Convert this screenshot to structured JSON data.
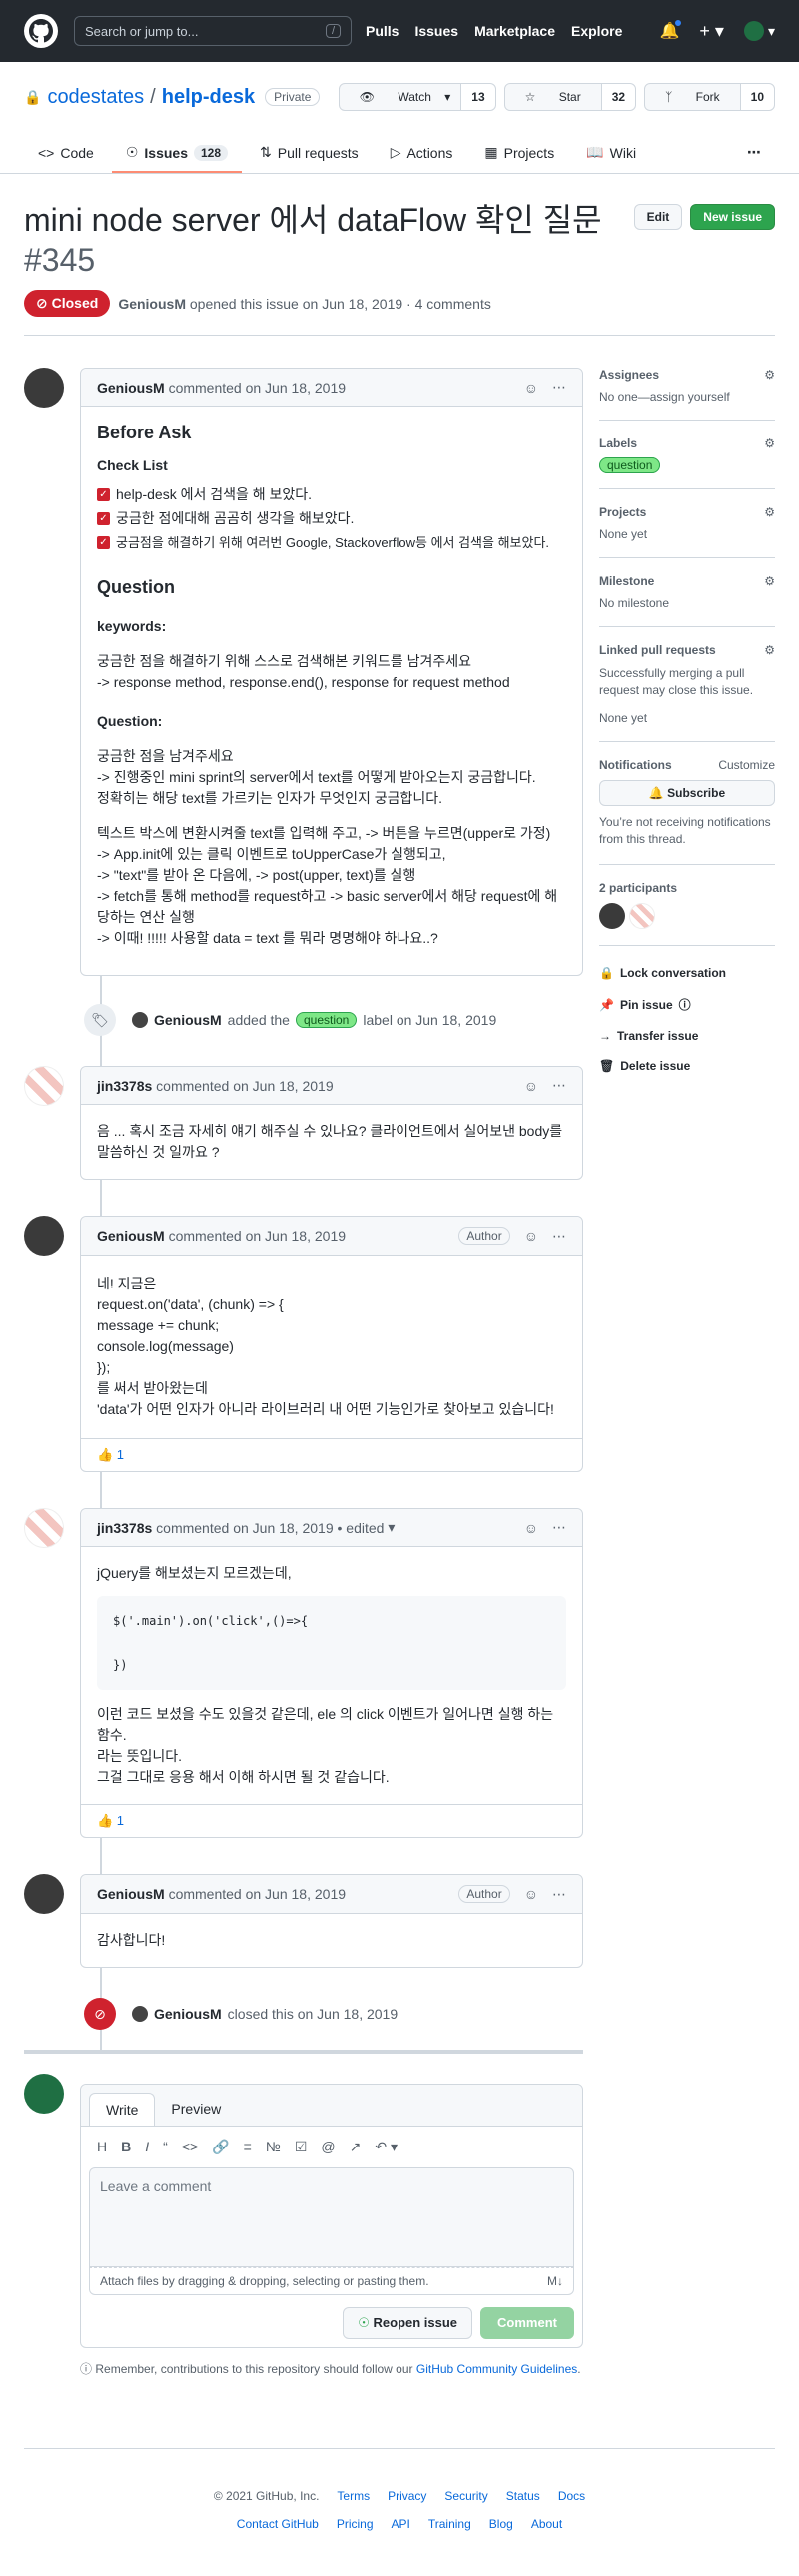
{
  "header": {
    "search_placeholder": "Search or jump to...",
    "slash": "/",
    "nav": [
      "Pulls",
      "Issues",
      "Marketplace",
      "Explore"
    ]
  },
  "repo": {
    "owner": "codestates",
    "sep": "/",
    "name": "help-desk",
    "visibility": "Private",
    "watch": "Watch",
    "watch_count": "13",
    "star": "Star",
    "star_count": "32",
    "fork": "Fork",
    "fork_count": "10"
  },
  "tabs": {
    "code": "Code",
    "issues": "Issues",
    "issues_count": "128",
    "pull_requests": "Pull requests",
    "actions": "Actions",
    "projects": "Projects",
    "wiki": "Wiki"
  },
  "issue": {
    "title": "mini node server 에서 dataFlow 확인 질문",
    "number": "#345",
    "edit": "Edit",
    "new_issue": "New issue",
    "state": "Closed",
    "author": "GeniousM",
    "meta": "opened this issue on Jun 18, 2019 · 4 comments"
  },
  "c1": {
    "author": "GeniousM",
    "meta": "commented on Jun 18, 2019",
    "h_before": "Before Ask",
    "h_check": "Check List",
    "checks": [
      "help-desk 에서 검색을 해 보았다.",
      "궁금한 점에대해 곰곰히 생각을 해보았다.",
      "궁금점을 해결하기 위해 여러번 Google, Stackoverflow등 에서 검색을 해보았다."
    ],
    "h_question": "Question",
    "h_keywords": "keywords:",
    "kw1": "궁금한 점을 해결하기 위해 스스로 검색해본 키워드를 남겨주세요",
    "kw2": "-> response method, response.end(), response for request method",
    "h_question2": "Question:",
    "q1": "궁금한 점을 남겨주세요",
    "q2": "-> 진행중인 mini sprint의 server에서 text를 어떻게 받아오는지 궁금합니다.",
    "q3": "정확히는 해당 text를 가르키는 인자가 무엇인지 궁금합니다.",
    "q4": "텍스트 박스에 변환시켜줄 text를 입력해 주고, -> 버튼을 누르면(upper로 가정)",
    "q5": "-> App.init에 있는 클릭 이벤트로 toUpperCase가 실행되고,",
    "q6": "-> \"text\"를 받아 온 다음에, -> post(upper, text)를 실행",
    "q7": "-> fetch를 통해 method를 request하고 -> basic server에서 해당 request에 해당하는 연산 실행",
    "q8": "-> 이때! !!!!! 사용할 data = text 를 뭐라 명명해야 하나요..?"
  },
  "e1": {
    "actor": "GeniousM",
    "added": "added the",
    "label": "question",
    "rest": "label on Jun 18, 2019"
  },
  "c2": {
    "author": "jin3378s",
    "meta": "commented on Jun 18, 2019",
    "body": "음 ... 혹시 조금 자세히 얘기 해주실 수 있나요? 클라이언트에서 실어보낸 body를 말씀하신 것 일까요 ?"
  },
  "c3": {
    "author": "GeniousM",
    "meta": "commented on Jun 18, 2019",
    "badge": "Author",
    "l1": "네! 지금은",
    "l2": "request.on('data', (chunk) => {",
    "l3": "message += chunk;",
    "l4": "console.log(message)",
    "l5": "});",
    "l6": "를 써서 받아왔는데",
    "l7": "'data'가 어떤 인자가 아니라 라이브러리 내 어떤 기능인가로 찾아보고 있습니다!",
    "reaction": "👍 1"
  },
  "c4": {
    "author": "jin3378s",
    "meta": "commented on Jun 18, 2019 • edited",
    "l1": "jQuery를 해보셨는지 모르겠는데,",
    "code1": "$('.main').on('click',()=>{",
    "code2": "})",
    "l2": "이런 코드 보셨을 수도 있을것 같은데, ele 의 click 이벤트가 일어나면 실행 하는 함수.",
    "l3": "라는 뜻입니다.",
    "l4": "그걸 그대로 응용 해서 이해 하시면 될 것 같습니다.",
    "reaction": "👍 1"
  },
  "c5": {
    "author": "GeniousM",
    "meta": "commented on Jun 18, 2019",
    "badge": "Author",
    "body": "감사합니다!"
  },
  "e2": {
    "actor": "GeniousM",
    "rest": "closed this on Jun 18, 2019"
  },
  "write": {
    "tab_write": "Write",
    "tab_preview": "Preview",
    "placeholder": "Leave a comment",
    "attach": "Attach files by dragging & dropping, selecting or pasting them.",
    "reopen": "Reopen issue",
    "comment": "Comment",
    "tip": "Remember, contributions to this repository should follow our",
    "tip_link": "GitHub Community Guidelines",
    "tip_end": "."
  },
  "sidebar": {
    "assignees": "Assignees",
    "assignees_val": "No one—assign yourself",
    "labels": "Labels",
    "label": "question",
    "projects": "Projects",
    "projects_val": "None yet",
    "milestone": "Milestone",
    "milestone_val": "No milestone",
    "linked": "Linked pull requests",
    "linked_desc": "Successfully merging a pull request may close this issue.",
    "linked_val": "None yet",
    "notifications": "Notifications",
    "customize": "Customize",
    "subscribe": "Subscribe",
    "notif_desc": "You’re not receiving notifications from this thread.",
    "participants": "2 participants",
    "lock": "Lock conversation",
    "pin": "Pin issue",
    "transfer": "Transfer issue",
    "delete": "Delete issue"
  },
  "footer": {
    "copy": "© 2021 GitHub, Inc.",
    "row1": [
      "Terms",
      "Privacy",
      "Security",
      "Status",
      "Docs"
    ],
    "row2": [
      "Contact GitHub",
      "Pricing",
      "API",
      "Training",
      "Blog",
      "About"
    ]
  }
}
